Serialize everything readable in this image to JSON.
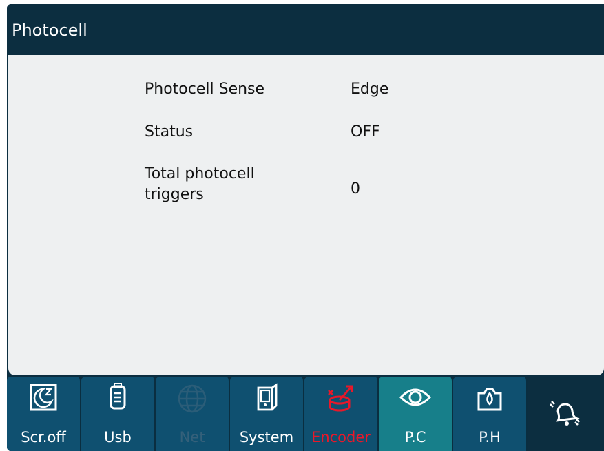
{
  "title": "Photocell",
  "rows": [
    {
      "label": "Photocell Sense",
      "value": "Edge"
    },
    {
      "label": "Status",
      "value": "OFF"
    },
    {
      "label": "Total photocell triggers",
      "value": "0"
    }
  ],
  "toolbar": [
    {
      "label": "Scr.off",
      "icon": "screen-off-icon",
      "state": "normal"
    },
    {
      "label": "Usb",
      "icon": "usb-icon",
      "state": "normal"
    },
    {
      "label": "Net",
      "icon": "globe-icon",
      "state": "disabled"
    },
    {
      "label": "System",
      "icon": "system-icon",
      "state": "normal"
    },
    {
      "label": "Encoder",
      "icon": "encoder-icon",
      "state": "alert"
    },
    {
      "label": "P.C",
      "icon": "eye-icon",
      "state": "active"
    },
    {
      "label": "P.H",
      "icon": "printhead-drop-icon",
      "state": "normal"
    },
    {
      "label": "",
      "icon": "bell-ringing-icon",
      "state": "normal"
    }
  ],
  "colors": {
    "header": "#0c2e40",
    "content_bg": "#eef0f1",
    "button": "#0f5070",
    "button_active": "#177f8a",
    "alert_red": "#e8182a",
    "disabled_text": "#34607a"
  }
}
